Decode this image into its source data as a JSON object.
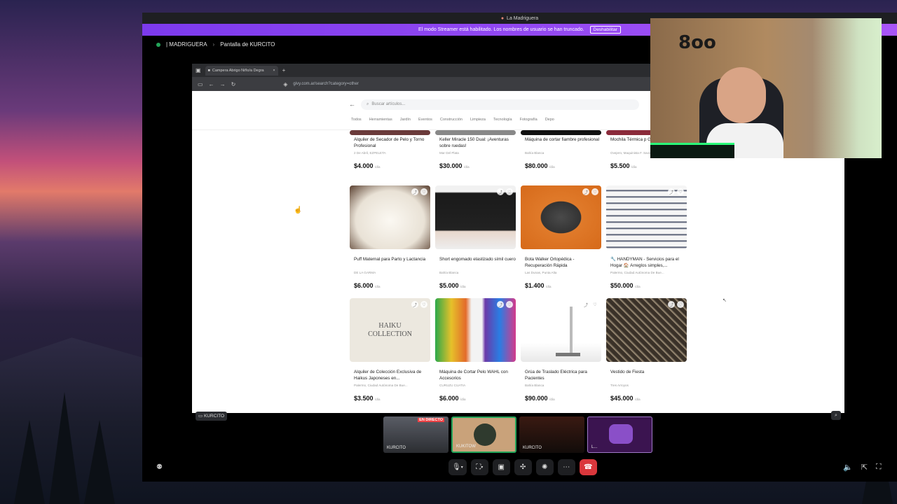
{
  "window": {
    "title": "La Madriguera",
    "streamer_notice": "El modo Streamer está habilitado. Los nombres de usuario se han truncado.",
    "streamer_button": "Deshabilitar"
  },
  "channel": {
    "server": "| MADRIGUERA",
    "screen": "Pantalla de KURCITO"
  },
  "browser": {
    "tab_title": "Campera Abrigo Niño/a Degra",
    "url": "givy.com.ar/search?category=other",
    "search_placeholder": "Buscar artículos...",
    "categories": [
      "Todos",
      "Herramientas",
      "Jardín",
      "Eventos",
      "Construcción",
      "Limpieza",
      "Tecnología",
      "Fotografía",
      "Depo"
    ]
  },
  "listings_row1": [
    {
      "title": "Alquiler de Secador de Pelo y Torno Profesional",
      "location": "2 De Abril, EZPELETA",
      "price": "$4.000",
      "unit": "/día"
    },
    {
      "title": "Keller Miracle 150 Dual: ¡Aventuras sobre ruedas!",
      "location": "Mar Del Plata",
      "price": "$30.000",
      "unit": "/día"
    },
    {
      "title": "Máquina de cortar fiambre profesional",
      "location": "Bahía Blanca",
      "price": "$80.000",
      "unit": "/día"
    },
    {
      "title": "Mochila Térmica p Grande Delivery c",
      "location": "Ovejero, Maquinista F. Savio",
      "price": "$5.500",
      "unit": "/día"
    }
  ],
  "listings_row2": [
    {
      "title": "Puff Maternal para Parto y Lactancia",
      "location": "DE LA GARMA",
      "price": "$6.000",
      "unit": "/día"
    },
    {
      "title": "Short engomado elastizado símil cuero",
      "location": "Bahía Blanca",
      "price": "$5.000",
      "unit": "/día"
    },
    {
      "title": "Bota Walker Ortopédica - Recuperación Rápida",
      "location": "Las Dunas, Punta Alta",
      "price": "$1.400",
      "unit": "/día"
    },
    {
      "title": "🔧 HANDYMAN - Servicios para el Hogar 🏠 Arreglos simples,...",
      "location": "Palermo, Ciudad Autónoma De Bue...",
      "price": "$50.000",
      "unit": "/día"
    }
  ],
  "listings_row3": [
    {
      "title": "Alquiler de Colección Exclusiva de Haikus Japoneses en...",
      "location": "Palermo, Ciudad Autónoma De Bue...",
      "price": "$3.500",
      "unit": "/día",
      "image_text": "HAIKU COLLECTION"
    },
    {
      "title": "Máquina de Cortar Pelo WAHL con Accesorios",
      "location": "CURUZU CUATIA",
      "price": "$6.000",
      "unit": "/día"
    },
    {
      "title": "Grúa de Traslado Eléctrica para Pacientes",
      "location": "Bahía Blanca",
      "price": "$90.000",
      "unit": "/día"
    },
    {
      "title": "Vestido de Fiesta",
      "location": "Tres Arroyos",
      "price": "$45.000",
      "unit": "/día"
    }
  ],
  "stream": {
    "screen_tag": "KURCITO",
    "thumbs": [
      {
        "label": "KURCITO",
        "live": "EN DIRECTO"
      },
      {
        "label": "KUKITOW"
      },
      {
        "label": "KURCITO"
      },
      {
        "label": "L..."
      }
    ]
  },
  "colors": {
    "streamer_bar": "#9146ff",
    "end_call": "#da373c"
  }
}
